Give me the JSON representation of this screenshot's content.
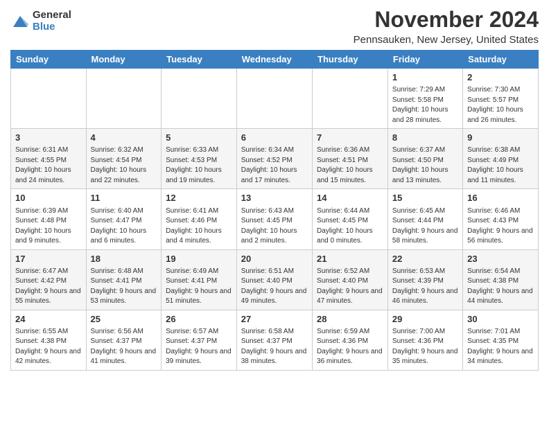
{
  "logo": {
    "general": "General",
    "blue": "Blue"
  },
  "title": "November 2024",
  "location": "Pennsauken, New Jersey, United States",
  "days_of_week": [
    "Sunday",
    "Monday",
    "Tuesday",
    "Wednesday",
    "Thursday",
    "Friday",
    "Saturday"
  ],
  "weeks": [
    [
      {
        "day": "",
        "info": ""
      },
      {
        "day": "",
        "info": ""
      },
      {
        "day": "",
        "info": ""
      },
      {
        "day": "",
        "info": ""
      },
      {
        "day": "",
        "info": ""
      },
      {
        "day": "1",
        "info": "Sunrise: 7:29 AM\nSunset: 5:58 PM\nDaylight: 10 hours and 28 minutes."
      },
      {
        "day": "2",
        "info": "Sunrise: 7:30 AM\nSunset: 5:57 PM\nDaylight: 10 hours and 26 minutes."
      }
    ],
    [
      {
        "day": "3",
        "info": "Sunrise: 6:31 AM\nSunset: 4:55 PM\nDaylight: 10 hours and 24 minutes."
      },
      {
        "day": "4",
        "info": "Sunrise: 6:32 AM\nSunset: 4:54 PM\nDaylight: 10 hours and 22 minutes."
      },
      {
        "day": "5",
        "info": "Sunrise: 6:33 AM\nSunset: 4:53 PM\nDaylight: 10 hours and 19 minutes."
      },
      {
        "day": "6",
        "info": "Sunrise: 6:34 AM\nSunset: 4:52 PM\nDaylight: 10 hours and 17 minutes."
      },
      {
        "day": "7",
        "info": "Sunrise: 6:36 AM\nSunset: 4:51 PM\nDaylight: 10 hours and 15 minutes."
      },
      {
        "day": "8",
        "info": "Sunrise: 6:37 AM\nSunset: 4:50 PM\nDaylight: 10 hours and 13 minutes."
      },
      {
        "day": "9",
        "info": "Sunrise: 6:38 AM\nSunset: 4:49 PM\nDaylight: 10 hours and 11 minutes."
      }
    ],
    [
      {
        "day": "10",
        "info": "Sunrise: 6:39 AM\nSunset: 4:48 PM\nDaylight: 10 hours and 9 minutes."
      },
      {
        "day": "11",
        "info": "Sunrise: 6:40 AM\nSunset: 4:47 PM\nDaylight: 10 hours and 6 minutes."
      },
      {
        "day": "12",
        "info": "Sunrise: 6:41 AM\nSunset: 4:46 PM\nDaylight: 10 hours and 4 minutes."
      },
      {
        "day": "13",
        "info": "Sunrise: 6:43 AM\nSunset: 4:45 PM\nDaylight: 10 hours and 2 minutes."
      },
      {
        "day": "14",
        "info": "Sunrise: 6:44 AM\nSunset: 4:45 PM\nDaylight: 10 hours and 0 minutes."
      },
      {
        "day": "15",
        "info": "Sunrise: 6:45 AM\nSunset: 4:44 PM\nDaylight: 9 hours and 58 minutes."
      },
      {
        "day": "16",
        "info": "Sunrise: 6:46 AM\nSunset: 4:43 PM\nDaylight: 9 hours and 56 minutes."
      }
    ],
    [
      {
        "day": "17",
        "info": "Sunrise: 6:47 AM\nSunset: 4:42 PM\nDaylight: 9 hours and 55 minutes."
      },
      {
        "day": "18",
        "info": "Sunrise: 6:48 AM\nSunset: 4:41 PM\nDaylight: 9 hours and 53 minutes."
      },
      {
        "day": "19",
        "info": "Sunrise: 6:49 AM\nSunset: 4:41 PM\nDaylight: 9 hours and 51 minutes."
      },
      {
        "day": "20",
        "info": "Sunrise: 6:51 AM\nSunset: 4:40 PM\nDaylight: 9 hours and 49 minutes."
      },
      {
        "day": "21",
        "info": "Sunrise: 6:52 AM\nSunset: 4:40 PM\nDaylight: 9 hours and 47 minutes."
      },
      {
        "day": "22",
        "info": "Sunrise: 6:53 AM\nSunset: 4:39 PM\nDaylight: 9 hours and 46 minutes."
      },
      {
        "day": "23",
        "info": "Sunrise: 6:54 AM\nSunset: 4:38 PM\nDaylight: 9 hours and 44 minutes."
      }
    ],
    [
      {
        "day": "24",
        "info": "Sunrise: 6:55 AM\nSunset: 4:38 PM\nDaylight: 9 hours and 42 minutes."
      },
      {
        "day": "25",
        "info": "Sunrise: 6:56 AM\nSunset: 4:37 PM\nDaylight: 9 hours and 41 minutes."
      },
      {
        "day": "26",
        "info": "Sunrise: 6:57 AM\nSunset: 4:37 PM\nDaylight: 9 hours and 39 minutes."
      },
      {
        "day": "27",
        "info": "Sunrise: 6:58 AM\nSunset: 4:37 PM\nDaylight: 9 hours and 38 minutes."
      },
      {
        "day": "28",
        "info": "Sunrise: 6:59 AM\nSunset: 4:36 PM\nDaylight: 9 hours and 36 minutes."
      },
      {
        "day": "29",
        "info": "Sunrise: 7:00 AM\nSunset: 4:36 PM\nDaylight: 9 hours and 35 minutes."
      },
      {
        "day": "30",
        "info": "Sunrise: 7:01 AM\nSunset: 4:35 PM\nDaylight: 9 hours and 34 minutes."
      }
    ]
  ]
}
